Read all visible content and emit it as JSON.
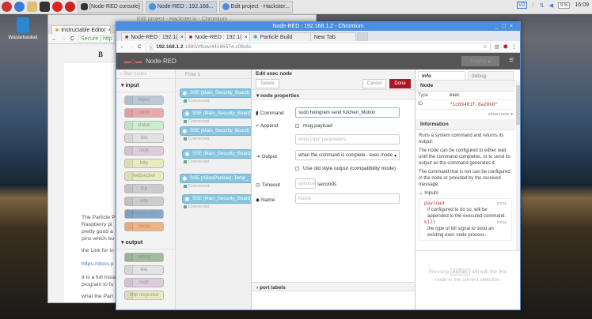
{
  "taskbar": {
    "tasks": [
      "[Node-RED console]",
      "Node-RED : 192.168...",
      "Edit project - Hackster..."
    ],
    "clock": "16:09",
    "cpu": "9 %",
    "ve": "V2"
  },
  "desktop": {
    "trash": "Wastebasket"
  },
  "back_window": {
    "title": "Edit project - Hackster.io - Chromium",
    "tab": "Instructable Editor",
    "secure": "Secure",
    "url": "http",
    "bold_btn": "B",
    "paragraphs": [
      "The Particle P",
      "Raspberry pi",
      "pretty good a",
      "pins which bu",
      "the Link for in",
      "https://docs.p",
      "It is a full insta",
      "program to fu",
      "what the Part"
    ]
  },
  "front_window": {
    "title": "Node-RED : 192.168.1.2 - Chromium",
    "tabs": [
      "Node-RED : 192.1(",
      "Node-RED : 192.1(",
      "Particle Build",
      "New Tab"
    ],
    "url_host": "192.168.1.2",
    "url_rest": ":1880/#flow/44166574.c08c6c"
  },
  "nodered": {
    "app": "Node-RED",
    "deploy": "Deploy",
    "filter": "filter nodes",
    "flow_tab": "Flow 1",
    "palette": {
      "input_label": "input",
      "input": [
        "inject",
        "catch",
        "status",
        "link",
        "mqtt",
        "http",
        "websocket",
        "tcp",
        "udp",
        "Watson IoT",
        "serial"
      ],
      "output_label": "output",
      "output": [
        "debug",
        "link",
        "mqtt",
        "http response"
      ]
    },
    "flow_nodes": [
      {
        "label": "SSE (Main_Security_Board)",
        "status": "Connected"
      },
      {
        "label": "SSE (Main_Security_Board)",
        "status": "Connected"
      },
      {
        "label": "SSE (Main_Security_Board)",
        "status": "Connected"
      },
      {
        "label": "SSE (Main_Security_Board)",
        "status": "Connected"
      },
      {
        "label": "SSE (XBeeParticle): Temp_",
        "status": "Connected"
      },
      {
        "label": "SSE (Main_Security_Board)",
        "status": "Connected"
      }
    ],
    "editor": {
      "title": "Edit exec node",
      "delete": "Delete",
      "cancel": "Cancel",
      "done": "Done",
      "section": "node properties",
      "command_label": "Command",
      "command_value": "sudo hologram send Kitchen_Motion",
      "append_label": "Append",
      "append_option": "msg.payload",
      "extra_placeholder": "extra input parameters",
      "output_label": "Output",
      "output_value": "when the command is complete - exec mode",
      "old_style": "Use old style output (compatibility mode)",
      "timeout_label": "Timeout",
      "timeout_placeholder": "optional",
      "timeout_unit": "seconds",
      "name_label": "Name",
      "name_placeholder": "Name",
      "port_labels": "port labels"
    },
    "sidebar": {
      "tab_info": "info",
      "tab_debug": "debug",
      "node_hdr": "Node",
      "type_k": "Type",
      "type_v": "exec",
      "id_k": "ID",
      "id_v": "\"1c69481f.6a20b0\"",
      "show_more": "show more ▾",
      "info_hdr": "Information",
      "p1": "Runs a system command and returns its output.",
      "p2": "The node can be configured to either wait until the command completes, or to send its output as the command generates it.",
      "p3": "The command that is run can be configured in the node or provided by the received message.",
      "inputs": "Inputs",
      "payload": "payload",
      "string": "string",
      "payload_desc": "if configured to do so, will be appended to the executed command.",
      "kill": "kill",
      "kill_desc": "the type of kill signal to send an existing exec node process.",
      "hint_pre": "Pressing",
      "hint_key": "enter",
      "hint_post": "will edit the first node in the current selection"
    }
  }
}
